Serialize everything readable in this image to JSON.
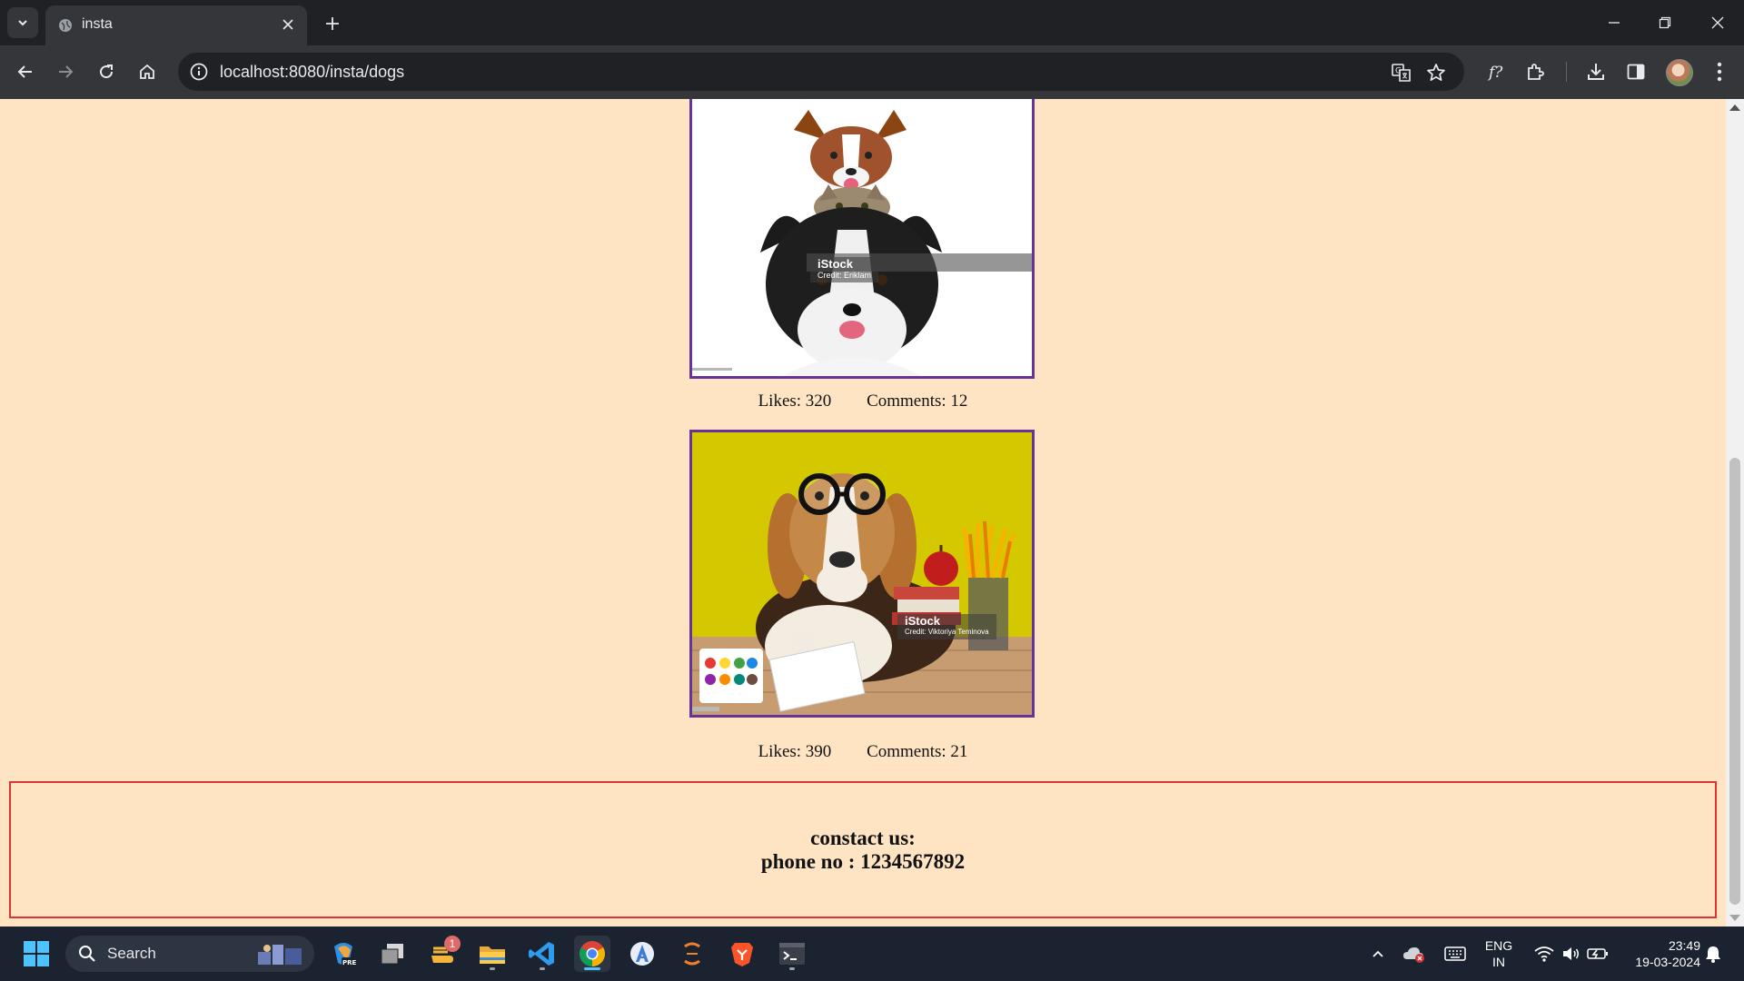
{
  "browser": {
    "tab_title": "insta",
    "url": "localhost:8080/insta/dogs"
  },
  "posts": [
    {
      "image_alt": "Dog, cat and dog stacked",
      "watermark_brand": "iStock",
      "watermark_credit": "Credit: Eriklam",
      "likes": "Likes: 320",
      "comments": "Comments: 12"
    },
    {
      "image_alt": "Beagle with glasses and school supplies",
      "watermark_brand": "iStock",
      "watermark_credit": "Credit: Viktoriya Teminova",
      "likes": "Likes: 390",
      "comments": "Comments: 21"
    }
  ],
  "footer": {
    "line1": "constact us:",
    "line2": "phone no : 1234567892"
  },
  "taskbar": {
    "search_label": "Search",
    "notification_badge": "1",
    "language_line1": "ENG",
    "language_line2": "IN",
    "time": "23:49",
    "date": "19-03-2024"
  },
  "colors": {
    "page_background": "#ffe4c4",
    "image_border": "#663399",
    "footer_border": "#e03232"
  }
}
